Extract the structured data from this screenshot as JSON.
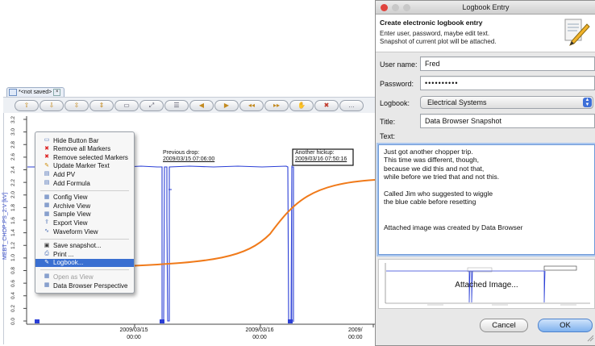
{
  "browser": {
    "tab_label": "*<not saved>",
    "toolbar_icons": [
      "zoom-in-icon",
      "zoom-out-icon",
      "zoom-in-time-icon",
      "zoom-out-time-icon",
      "stagger-icon",
      "autoscale-icon",
      "zoom-fit-icon",
      "scroll-left-icon",
      "scroll-right-icon",
      "back-icon",
      "forward-icon",
      "pan-icon",
      "clear-icon",
      "more-icon"
    ],
    "y_axis_label": "MEBT_CHOP:PS_2:V [kV]",
    "y_ticks": [
      "0.0",
      "0.2",
      "0.4",
      "0.6",
      "0.8",
      "1.0",
      "1.2",
      "1.4",
      "1.6",
      "1.8",
      "2.0",
      "2.2",
      "2.4",
      "2.6",
      "2.8",
      "3.0",
      "3.2"
    ],
    "x_ticks": [
      {
        "date": "2009/03/15",
        "time": "00:00"
      },
      {
        "date": "2009/03/16",
        "time": "00:00"
      },
      {
        "date": "2009/",
        "time": "00:00"
      }
    ],
    "annotation1": {
      "title": "Previous drop:",
      "value": "2009/03/15 07:06:00"
    },
    "annotation2": {
      "title": "Another hickup:",
      "value": "2009/03/16 07:50:16"
    }
  },
  "menu": {
    "group1": [
      {
        "label": "Hide Button Bar",
        "icon": "hide-bar-icon"
      },
      {
        "label": "Remove all Markers",
        "icon": "remove-markers-icon"
      },
      {
        "label": "Remove selected Markers",
        "icon": "remove-selected-icon"
      },
      {
        "label": "Update Marker Text",
        "icon": "pencil-icon"
      },
      {
        "label": "Add PV",
        "icon": "add-pv-icon"
      },
      {
        "label": "Add Formula",
        "icon": "add-formula-icon"
      }
    ],
    "group2": [
      {
        "label": "Config View",
        "icon": "config-view-icon"
      },
      {
        "label": "Archive View",
        "icon": "archive-view-icon"
      },
      {
        "label": "Sample View",
        "icon": "sample-view-icon"
      },
      {
        "label": "Export View",
        "icon": "export-view-icon"
      },
      {
        "label": "Waveform View",
        "icon": "waveform-view-icon"
      }
    ],
    "group3": [
      {
        "label": "Save snapshot...",
        "icon": "camera-icon"
      },
      {
        "label": "Print ...",
        "icon": "printer-icon"
      },
      {
        "label": "Logbook...",
        "icon": "logbook-icon",
        "selected": true
      }
    ],
    "group4": [
      {
        "label": "Open as View",
        "icon": "open-view-icon",
        "disabled": true
      },
      {
        "label": "Data Browser Perspective",
        "icon": "perspective-icon"
      }
    ]
  },
  "dialog": {
    "title": "Logbook Entry",
    "header_title": "Create electronic logbook entry",
    "header_desc_1": "Enter user, password, maybe edit text.",
    "header_desc_2": "Snapshot of current plot will be attached.",
    "user_label": "User name:",
    "user_value": "Fred",
    "password_label": "Password:",
    "password_value": "••••••••••",
    "logbook_label": "Logbook:",
    "logbook_value": "Electrical Systems",
    "title_label": "Title:",
    "title_value": "Data Browser Snapshot",
    "text_label": "Text:",
    "text_lines": [
      "Just got another chopper trip.",
      "This time was different, though,",
      "because we did this and not that,",
      "while before we tried that and not this.",
      "",
      "Called Jim who suggested to wiggle",
      "the blue cable before resetting",
      "",
      "",
      "Attached image was created by Data Browser"
    ],
    "attached_label": "Attached Image...",
    "cancel_label": "Cancel",
    "ok_label": "OK"
  },
  "colors": {
    "accent": "#3a6fd1",
    "trace": "#2b3fd6",
    "arrow": "#f07a1a"
  }
}
